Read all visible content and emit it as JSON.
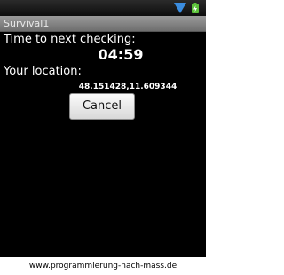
{
  "window": {
    "title": "Survival1"
  },
  "main": {
    "time_label": "Time to next checking:",
    "countdown": "04:59",
    "location_label": "Your location:",
    "coordinates": "48.151428,11.609344",
    "cancel_label": "Cancel"
  },
  "footer": {
    "text": "www.programmierung-nach-mass.de"
  },
  "icons": {
    "signal": "signal-strength-icon",
    "battery": "battery-icon"
  },
  "colors": {
    "screen_background": "#000000",
    "signal": "#3b8de0",
    "battery": "#5cc23a"
  }
}
